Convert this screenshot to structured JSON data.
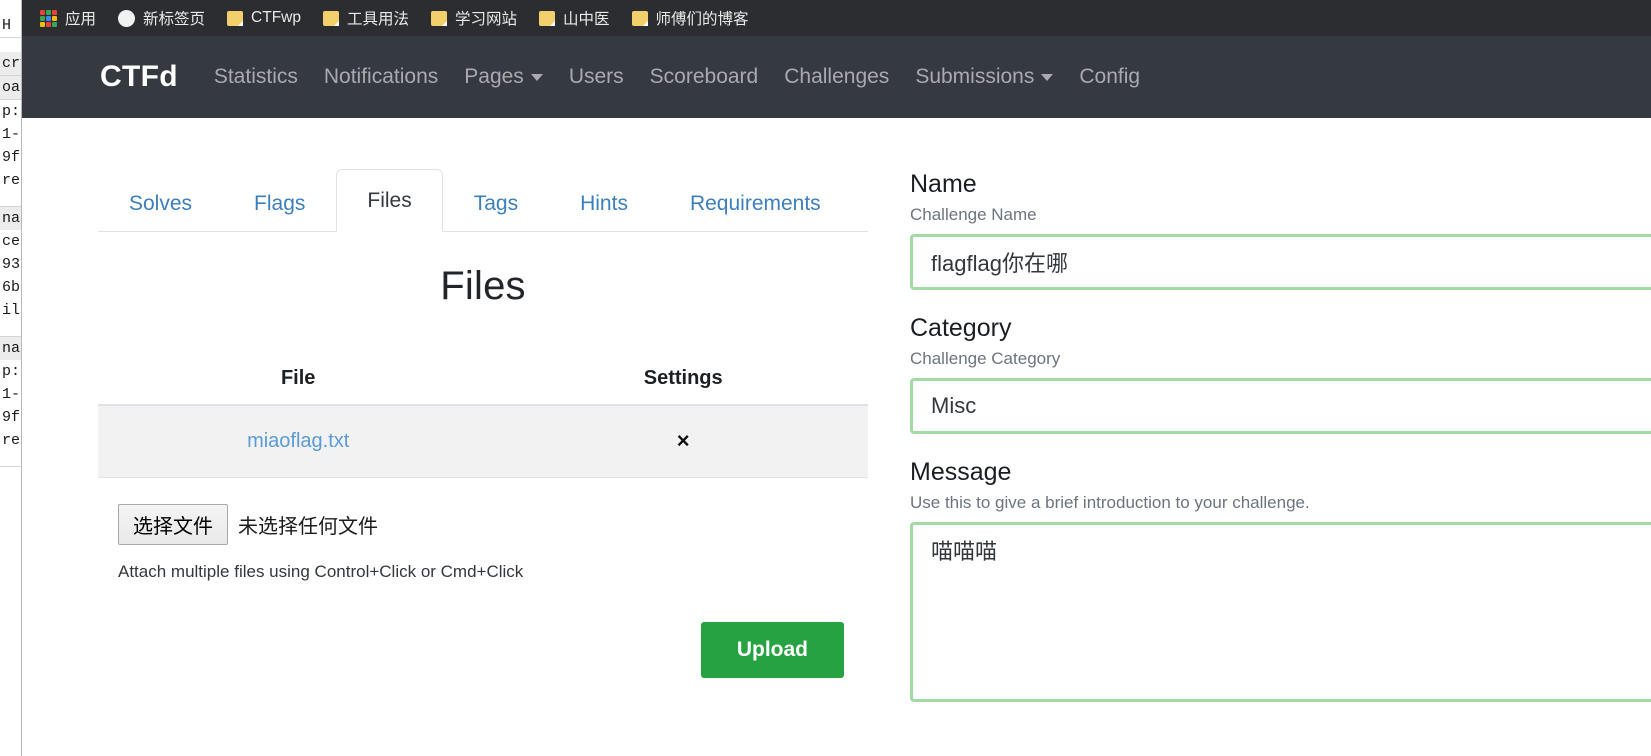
{
  "background_window": {
    "lines": [
      "H",
      "cry",
      "oa",
      "p:",
      "1-",
      "9f",
      "re",
      "nab",
      "ce",
      "93",
      "6b",
      "il",
      "nab",
      "p:",
      "1-",
      "9f",
      "re"
    ]
  },
  "bookmarks_bar": {
    "items": [
      {
        "label": "应用",
        "icon": "apps-grid-icon"
      },
      {
        "label": "新标签页",
        "icon": "new-tab-circle-icon"
      },
      {
        "label": "CTFwp",
        "icon": "folder-icon"
      },
      {
        "label": "工具用法",
        "icon": "folder-icon"
      },
      {
        "label": "学习网站",
        "icon": "folder-icon"
      },
      {
        "label": "山中医",
        "icon": "folder-icon"
      },
      {
        "label": "师傅们的博客",
        "icon": "folder-icon"
      }
    ]
  },
  "navbar": {
    "brand": "CTFd",
    "items": [
      {
        "label": "Statistics",
        "caret": false
      },
      {
        "label": "Notifications",
        "caret": false
      },
      {
        "label": "Pages",
        "caret": true
      },
      {
        "label": "Users",
        "caret": false
      },
      {
        "label": "Scoreboard",
        "caret": false
      },
      {
        "label": "Challenges",
        "caret": false
      },
      {
        "label": "Submissions",
        "caret": true
      },
      {
        "label": "Config",
        "caret": false
      }
    ]
  },
  "tabs": [
    {
      "label": "Solves",
      "active": false
    },
    {
      "label": "Flags",
      "active": false
    },
    {
      "label": "Files",
      "active": true
    },
    {
      "label": "Tags",
      "active": false
    },
    {
      "label": "Hints",
      "active": false
    },
    {
      "label": "Requirements",
      "active": false
    }
  ],
  "files_panel": {
    "title": "Files",
    "table": {
      "headers": [
        "File",
        "Settings"
      ],
      "rows": [
        {
          "file": "miaoflag.txt",
          "delete_icon": "×"
        }
      ]
    },
    "file_input": {
      "button_label": "选择文件",
      "status_text": "未选择任何文件"
    },
    "attach_help": "Attach multiple files using Control+Click or Cmd+Click",
    "upload_button": "Upload"
  },
  "challenge_form": {
    "name": {
      "label": "Name",
      "help": "Challenge Name",
      "value": "flagflag你在哪",
      "placeholder": ""
    },
    "category": {
      "label": "Category",
      "help": "Challenge Category",
      "value": "Misc",
      "placeholder": ""
    },
    "message": {
      "label": "Message",
      "help": "Use this to give a brief introduction to your challenge.",
      "value": "喵喵喵",
      "placeholder": ""
    }
  },
  "colors": {
    "navbar_bg": "#343a40",
    "bookmarks_bg": "#2b2d30",
    "tab_link": "#3c7fbd",
    "upload_green": "#27a243",
    "valid_border": "#a3d9a5",
    "file_link": "#5b9bd5"
  }
}
